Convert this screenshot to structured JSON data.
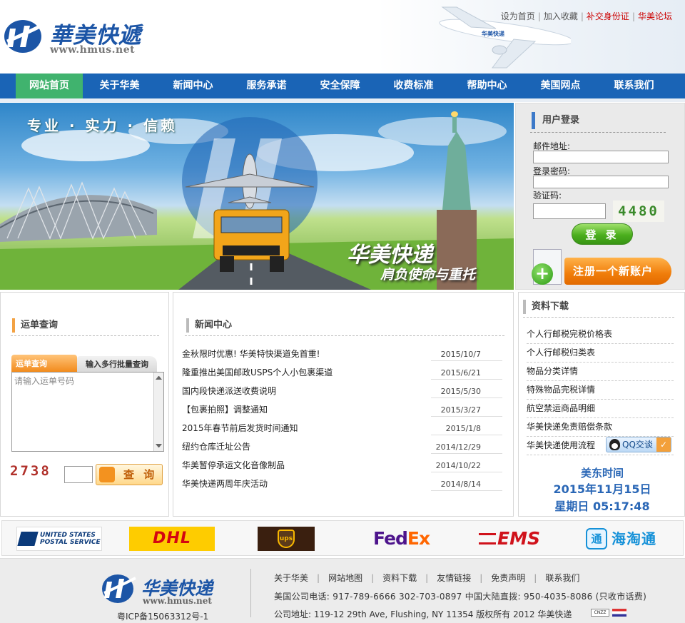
{
  "header": {
    "logo_cn": "華美快遞",
    "logo_en": "www.hmus.net",
    "top_links": [
      {
        "label": "设为首页",
        "color": "#555555"
      },
      {
        "label": "加入收藏",
        "color": "#555555"
      },
      {
        "label": "补交身份证",
        "color": "#cc0000"
      },
      {
        "label": "华美论坛",
        "color": "#cc0000"
      }
    ]
  },
  "nav": {
    "items": [
      "网站首页",
      "关于华美",
      "新闻中心",
      "服务承诺",
      "安全保障",
      "收费标准",
      "帮助中心",
      "美国网点",
      "联系我们"
    ],
    "active_index": 0
  },
  "banner": {
    "slogan": "专业 · 实力 · 信赖",
    "title": "华美快递",
    "subtitle": "肩负使命与重托"
  },
  "login": {
    "heading": "用户登录",
    "email_label": "邮件地址:",
    "password_label": "登录密码:",
    "captcha_label": "验证码:",
    "captcha_code": "4480",
    "login_button": "登 录",
    "register_label": "注册一个新账户"
  },
  "tracking": {
    "heading": "运单查询",
    "tab_single": "运单查询",
    "tab_batch": "输入多行批量查询",
    "placeholder": "请输入运单号码",
    "captcha_code": "2738",
    "query_button": "查 询"
  },
  "news": {
    "heading": "新闻中心",
    "items": [
      {
        "title": "金秋限时优惠! 华美特快渠道免首重!",
        "date": "2015/10/7"
      },
      {
        "title": "隆重推出美国邮政USPS个人小包裹渠道",
        "date": "2015/6/21"
      },
      {
        "title": "国内段快递派送收费说明",
        "date": "2015/5/30"
      },
      {
        "title": "【包裹拍照】调整通知",
        "date": "2015/3/27"
      },
      {
        "title": "2015年春节前后发货时间通知",
        "date": "2015/1/8"
      },
      {
        "title": "纽约仓库迁址公告",
        "date": "2014/12/29"
      },
      {
        "title": "华美暂停承运文化音像制品",
        "date": "2014/10/22"
      },
      {
        "title": "华美快递两周年庆活动",
        "date": "2014/8/14"
      }
    ]
  },
  "downloads": {
    "heading": "资料下载",
    "items": [
      "个人行邮税完税价格表",
      "个人行邮税归类表",
      "物品分类详情",
      "特殊物品完税详情",
      "航空禁运商品明细",
      "华美快递免责赔偿条款",
      "华美快递使用流程"
    ],
    "qq_label": "QQ交谈"
  },
  "clock": {
    "label": "美东时间",
    "date": "2015年11月15日",
    "time": "星期日 05:17:48"
  },
  "partners": {
    "usps_line1": "UNITED STATES",
    "usps_line2": "POSTAL SERVICE",
    "dhl": "DHL",
    "ups": "ups",
    "fedex_a": "Fed",
    "fedex_b": "Ex",
    "ems": "EMS",
    "htt_icon": "通",
    "htt": "海淘通"
  },
  "footer": {
    "logo_cn": "华美快递",
    "logo_en": "www.hmus.net",
    "icp": "粤ICP备15063312号-1",
    "links": [
      "关于华美",
      "网站地图",
      "资料下载",
      "友情链接",
      "免责声明",
      "联系我们"
    ],
    "phones": "美国公司电话: 917-789-6666 302-703-0897  中国大陆直拨: 950-4035-8086 (只收市话费)",
    "address": "公司地址: 119-12 29th Ave, Flushing, NY 11354  版权所有 2012 华美快递",
    "badge": "CNZZ"
  },
  "colors": {
    "brand_blue": "#1a64b6",
    "nav_active": "#40b36e",
    "accent_orange": "#f28b1c",
    "clock_blue": "#2a67b6"
  }
}
